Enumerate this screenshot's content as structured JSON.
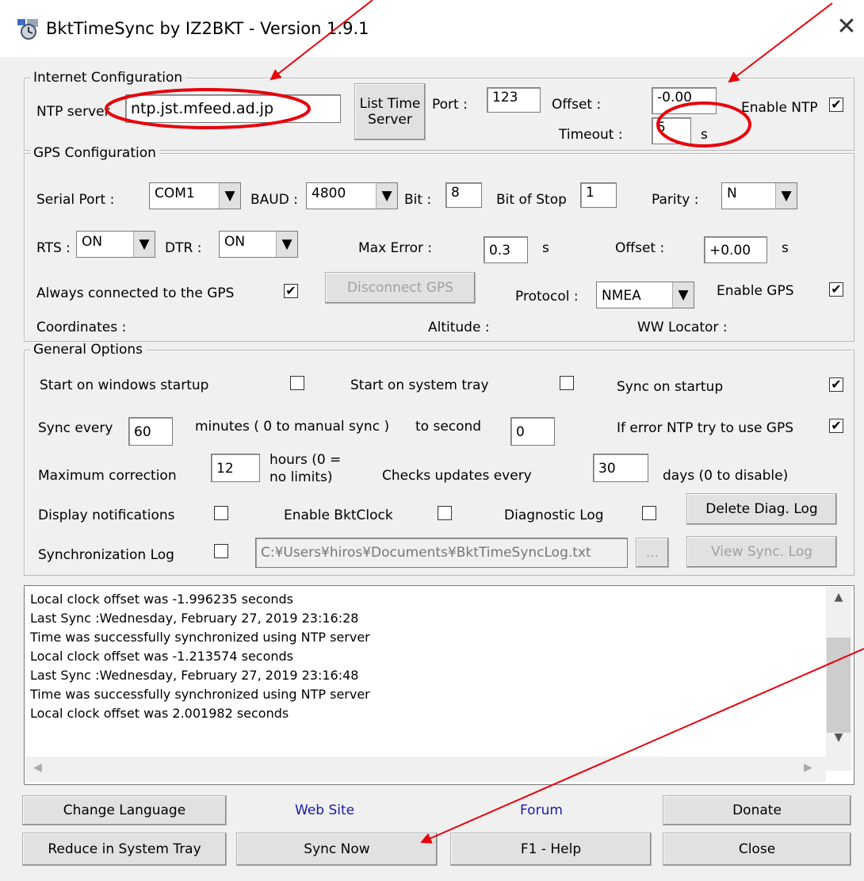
{
  "window": {
    "title": "BktTimeSync by IZ2BKT - Version 1.9.1"
  },
  "internet": {
    "legend": "Internet Configuration",
    "ntp_label": "NTP server",
    "ntp_value": "ntp.jst.mfeed.ad.jp",
    "list_btn_line1": "List Time",
    "list_btn_line2": "Server",
    "port_label": "Port :",
    "port_value": "123",
    "offset_label": "Offset :",
    "offset_value": "-0.00",
    "timeout_label": "Timeout :",
    "timeout_value": "5",
    "timeout_unit": "s",
    "enable_ntp_label": "Enable NTP",
    "enable_ntp_checked": true
  },
  "gps": {
    "legend": "GPS Configuration",
    "serial_label": "Serial Port :",
    "serial_value": "COM1",
    "baud_label": "BAUD :",
    "baud_value": "4800",
    "bit_label": "Bit :",
    "bit_value": "8",
    "stop_label": "Bit of Stop",
    "stop_value": "1",
    "parity_label": "Parity :",
    "parity_value": "N",
    "rts_label": "RTS :",
    "rts_value": "ON",
    "dtr_label": "DTR :",
    "dtr_value": "ON",
    "maxerr_label": "Max Error :",
    "maxerr_value": "0.3",
    "maxerr_unit": "s",
    "offset_label": "Offset :",
    "offset_value": "+0.00",
    "offset_unit": "s",
    "always_label": "Always connected to the GPS",
    "always_checked": true,
    "disconnect_btn": "Disconnect GPS",
    "protocol_label": "Protocol :",
    "protocol_value": "NMEA",
    "enable_gps_label": "Enable GPS",
    "enable_gps_checked": true,
    "coords_label": "Coordinates :",
    "altitude_label": "Altitude :",
    "locator_label": "WW Locator :"
  },
  "general": {
    "legend": "General Options",
    "startup_label": "Start on windows startup",
    "startup_checked": false,
    "tray_label": "Start on system tray",
    "tray_checked": false,
    "sync_startup_label": "Sync on startup",
    "sync_startup_checked": true,
    "sync_every_label": "Sync every",
    "sync_every_value": "60",
    "minutes_label": "minutes ( 0 to manual sync )",
    "to_second_label": "to second",
    "to_second_value": "0",
    "error_ntp_label": "If error NTP try to use GPS",
    "error_ntp_checked": true,
    "max_corr_label": "Maximum correction",
    "max_corr_value": "12",
    "hours_line1": "hours (0 =",
    "hours_line2": "no limits)",
    "checks_label": "Checks updates every",
    "checks_value": "30",
    "days_label": "days (0 to disable)",
    "notif_label": "Display notifications",
    "notif_checked": false,
    "bktclock_label": "Enable BktClock",
    "bktclock_checked": false,
    "diag_label": "Diagnostic Log",
    "diag_checked": false,
    "delete_diag_btn": "Delete Diag. Log",
    "synclog_label": "Synchronization Log",
    "synclog_checked": false,
    "synclog_path": "C:¥Users¥hiros¥Documents¥BktTimeSyncLog.txt",
    "browse_btn": "...",
    "view_sync_btn": "View Sync. Log"
  },
  "log": {
    "lines": [
      "Local clock offset was -1.996235 seconds",
      "Last Sync :Wednesday, February 27, 2019 23:16:28",
      "Time was successfully synchronized using NTP server",
      "Local clock offset was -1.213574 seconds",
      "Last Sync :Wednesday, February 27, 2019 23:16:48",
      "Time was successfully synchronized using NTP server",
      "Local clock offset was 2.001982 seconds"
    ]
  },
  "bottom": {
    "change_lang": "Change Language",
    "website": "Web Site",
    "forum": "Forum",
    "donate": "Donate",
    "reduce": "Reduce in System Tray",
    "sync_now": "Sync Now",
    "help": "F1 - Help",
    "close": "Close"
  },
  "colors": {
    "annotation": "#e8000b",
    "link": "#1a1aa6"
  },
  "icons": {
    "app": "app-clock-icon",
    "close": "close-icon",
    "check": "check-mark-icon",
    "dropdown": "dropdown-arrow-icon"
  }
}
